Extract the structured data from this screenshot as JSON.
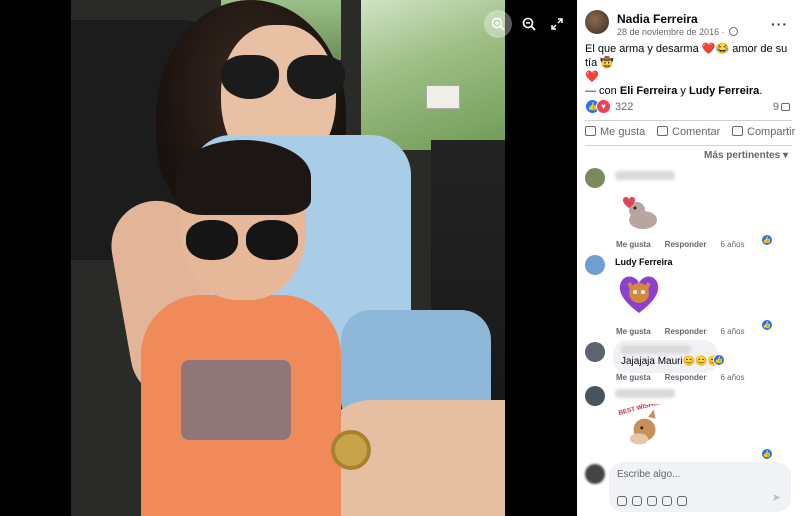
{
  "viewer": {
    "controls": {
      "zoom_in": "zoom-in-icon",
      "zoom_out": "zoom-out-icon",
      "fullscreen": "fullscreen-icon"
    }
  },
  "post": {
    "author": "Nadia Ferreira",
    "date": "28 de noviembre de 2016",
    "audience_icon": "globe-icon",
    "text_line1": "El que arma y desarma ❤️😂 amor de su tía 🤠",
    "text_line2": "❤️",
    "with_prefix": "— con ",
    "tag1": "Eli Ferreira",
    "with_join": " y ",
    "tag2": "Ludy Ferreira",
    "with_suffix": ".",
    "reaction_count": "322",
    "comment_count": "9",
    "actions": {
      "like": "Me gusta",
      "comment": "Comentar",
      "share": "Compartir"
    },
    "sort_label": "Más pertinentes"
  },
  "comments": [
    {
      "name": "",
      "type": "sticker",
      "like_label": "Me gusta",
      "reply_label": "Responder",
      "age": "6 años"
    },
    {
      "name": "Ludy Ferreira",
      "type": "sticker",
      "like_label": "Me gusta",
      "reply_label": "Responder",
      "age": "6 años"
    },
    {
      "name": "",
      "type": "text",
      "text": "Jajajaja Mauri😊😊😊",
      "like_label": "Me gusta",
      "reply_label": "Responder",
      "age": "6 años"
    },
    {
      "name": "",
      "type": "sticker",
      "sticker_text": "BEST WISHES"
    }
  ],
  "composer": {
    "placeholder": "Escribe algo..."
  },
  "colors": {
    "accent": "#1877f2",
    "love": "#f33e58",
    "panel_bg": "#ffffff"
  }
}
